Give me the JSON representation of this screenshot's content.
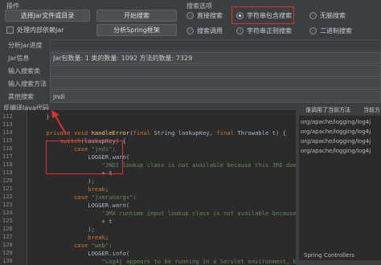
{
  "ops": {
    "title": "操作",
    "select_jar_label": "选择Jar文件或目录",
    "start_search_label": "开始搜索",
    "internal_deps_label": "处理内部依赖Jar",
    "analyze_spring_label": "分析Spring框架"
  },
  "search_opts": {
    "title": "搜索选项",
    "options": [
      "直接搜索",
      "字符串包含搜索",
      "无脑搜索",
      "搜索调用",
      "字符串正则搜索",
      "二进制搜索"
    ],
    "selected": "字符串包含搜索"
  },
  "form": {
    "progress_label": "分析Jar进度",
    "info_label": "Jar信息",
    "info_value": "Jar包数量: 1   类的数量: 1092   方法的数量: 7329",
    "class_label": "输入搜索类",
    "method_label": "输入搜索方法",
    "other_label": "其他搜索",
    "other_value": "jndi"
  },
  "decompile": {
    "title": "反编译Java代码"
  },
  "code": {
    "lines": [
      {
        "no": "112",
        "text": "    }"
      },
      {
        "no": "113",
        "text": ""
      },
      {
        "no": "114",
        "text": "    private void handleError(final String lookupKey, final Throwable t) {"
      },
      {
        "no": "115",
        "text": "        switch(lookupKey) {"
      },
      {
        "no": "116",
        "text": "            case \"jndi\":"
      },
      {
        "no": "117",
        "text": "                LOGGER.warn("
      },
      {
        "no": "118",
        "text": "                    \"JNDI lookup class is not available because this JRE does not s"
      },
      {
        "no": "119",
        "text": "                    + t"
      },
      {
        "no": "120",
        "text": "                );"
      },
      {
        "no": "121",
        "text": "                break;"
      },
      {
        "no": "122",
        "text": "            case \"jvmrunargs\":"
      },
      {
        "no": "123",
        "text": "                LOGGER.warn("
      },
      {
        "no": "124",
        "text": "                    \"JMX runtime input lookup class is not available because this"
      },
      {
        "no": "125",
        "text": "                    + t"
      },
      {
        "no": "126",
        "text": "                );"
      },
      {
        "no": "127",
        "text": "                break;"
      },
      {
        "no": "128",
        "text": "            case \"web\":"
      },
      {
        "no": "129",
        "text": "                LOGGER.info("
      },
      {
        "no": "130",
        "text": "                    \"Log4j appears to be running in a Servlet environment, but the"
      }
    ]
  },
  "right": {
    "tab1": "谁调用了当前方法",
    "tab2": "当前方",
    "items": [
      "org/apache/logging/log4j",
      "org/apache/logging/log4j",
      "org/apache/logging/log4j",
      "org/apache/logging/log4j"
    ],
    "bottom": "Spring Controllers"
  },
  "colors": {
    "highlight": "#e03030",
    "keyword": "#cc7832",
    "string": "#6a8759",
    "method": "#ffc66d"
  }
}
